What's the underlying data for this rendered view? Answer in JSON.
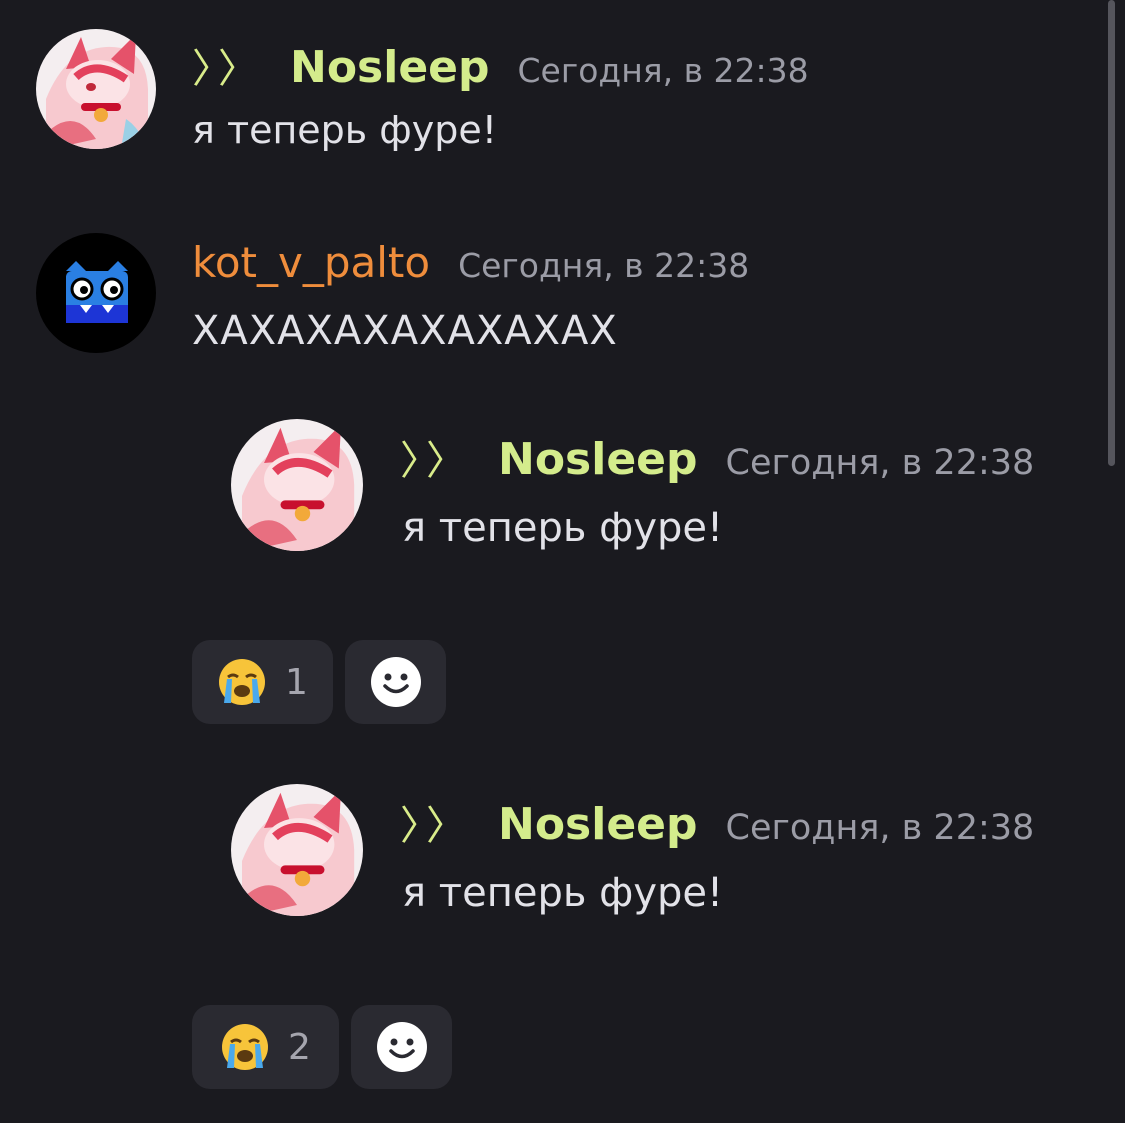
{
  "messages": [
    {
      "author": "Nosleep",
      "decor": "〉〉",
      "time": "Сегодня, в 22:38",
      "text": "я теперь фуре!",
      "color": "#d4ec8c"
    },
    {
      "author": "kot_v_palto",
      "time": "Сегодня, в 22:38",
      "text": "ХАХАХАХАХАХАХАХ",
      "color": "#ef8d3c"
    }
  ],
  "embeds": [
    {
      "author": "Nosleep",
      "decor": "〉〉",
      "time": "Сегодня, в 22:38",
      "text": "я теперь фуре!",
      "reaction": {
        "emoji": "crying-emoji",
        "count": "1"
      }
    },
    {
      "author": "Nosleep",
      "decor": "〉〉",
      "time": "Сегодня, в 22:38",
      "text": "я теперь фуре!",
      "reaction": {
        "emoji": "crying-emoji",
        "count": "2"
      }
    }
  ],
  "icons": {
    "add_reaction": "smiley-icon"
  },
  "colors": {
    "background": "#1a1a1f",
    "pill": "#2a2a31",
    "username_green": "#d4ec8c",
    "username_orange": "#ef8d3c"
  }
}
